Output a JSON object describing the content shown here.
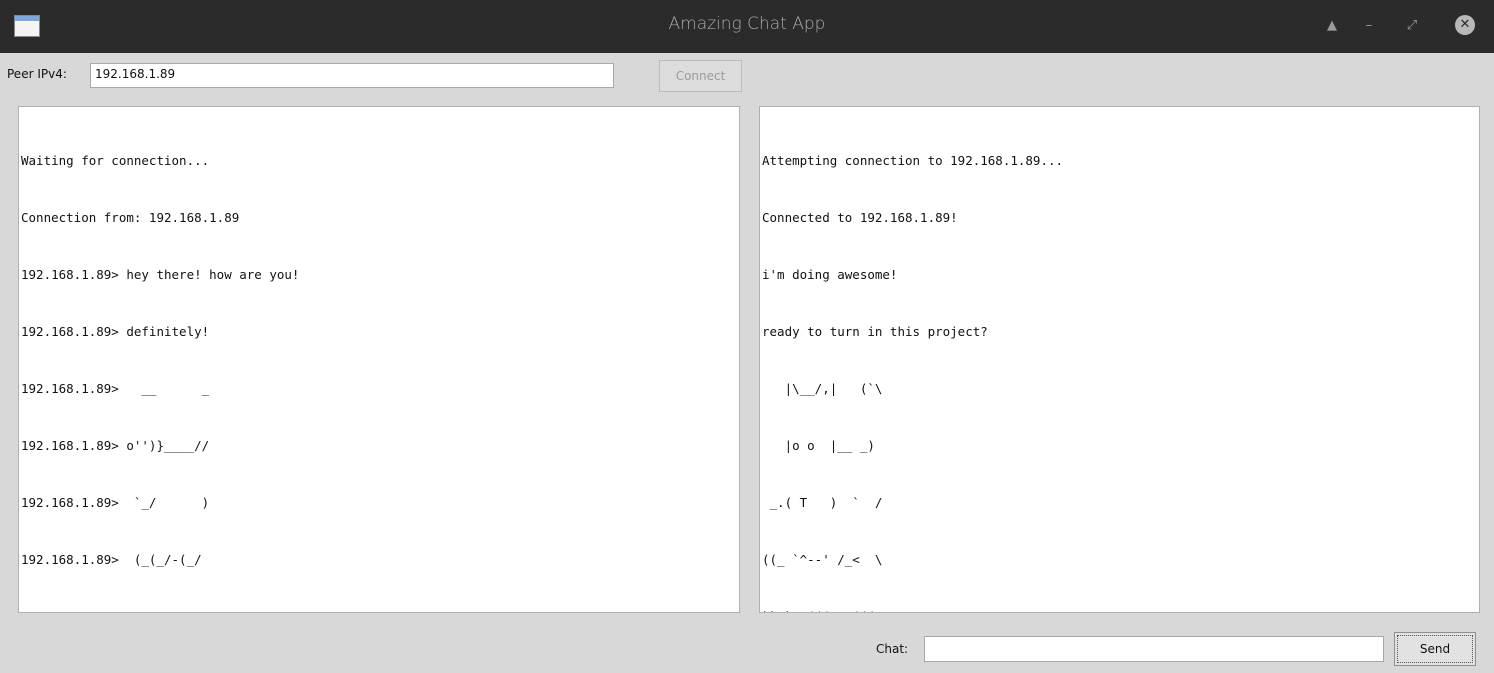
{
  "window": {
    "title": "Amazing Chat App",
    "controls": {
      "shade": "▲",
      "minimize": "–",
      "maximize": "⤢",
      "close": "✕"
    }
  },
  "peer": {
    "label": "Peer IPv4:",
    "value": "192.168.1.89",
    "connect_label": "Connect"
  },
  "left_log": [
    "Waiting for connection...",
    "Connection from: 192.168.1.89",
    "192.168.1.89> hey there! how are you!",
    "192.168.1.89> definitely!",
    "192.168.1.89>   __      _",
    "192.168.1.89> o'')}____//",
    "192.168.1.89>  `_/      )",
    "192.168.1.89>  (_(_/-(_/"
  ],
  "right_log": [
    "Attempting connection to 192.168.1.89...",
    "Connected to 192.168.1.89!",
    "i'm doing awesome!",
    "ready to turn in this project?",
    "   |\\__/,|   (`\\",
    "   |o o  |__ _)",
    " _.( T   )  `  /",
    "((_ `^--' /_<  \\",
    "`` `-'(((/  (((/"
  ],
  "chat": {
    "label": "Chat:",
    "value": "",
    "send_label": "Send"
  }
}
